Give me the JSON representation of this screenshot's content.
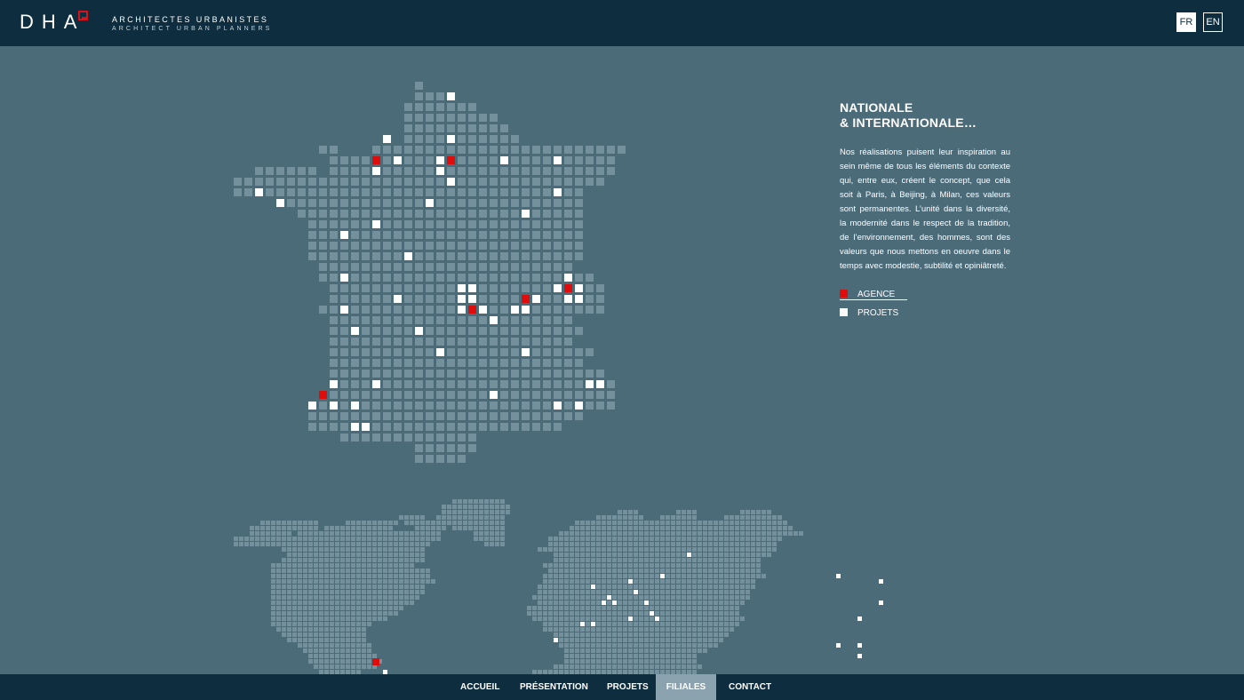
{
  "header": {
    "logo": "DHA",
    "tagline_line1": "ARCHITECTES URBANISTES",
    "tagline_line2": "ARCHITECT URBAN PLANNERS",
    "languages": [
      "FR",
      "EN"
    ],
    "active_language": "FR"
  },
  "content": {
    "title_line1": "NATIONALE",
    "title_line2": "& INTERNATIONALE…",
    "paragraph": "Nos réalisations puisent leur inspiration au sein même de tous les éléments du contexte qui, entre eux, créent le concept, que cela soit à Paris, à Beijing, à Milan, ces valeurs sont permanentes. L’unité dans la diversité, la modernité dans le respect de la tradition, de l’environnement, des hommes, sont des valeurs que nous mettons en oeuvre dans le temps avec modestie, subtilité et opiniâtreté."
  },
  "legend": {
    "agence_label": "AGENCE",
    "projets_label": "PROJETS"
  },
  "nav": {
    "items": [
      "ACCUEIL",
      "PRÉSENTATION",
      "PROJETS",
      "FILIALES",
      "CONTACT"
    ],
    "active": "FILIALES"
  },
  "colors": {
    "background": "#4c6b79",
    "bar": "#0e2d3e",
    "map_tile": "#73909c",
    "agence": "#e00b0b",
    "projet": "#ffffff",
    "nav_active": "#8aa3ae"
  }
}
